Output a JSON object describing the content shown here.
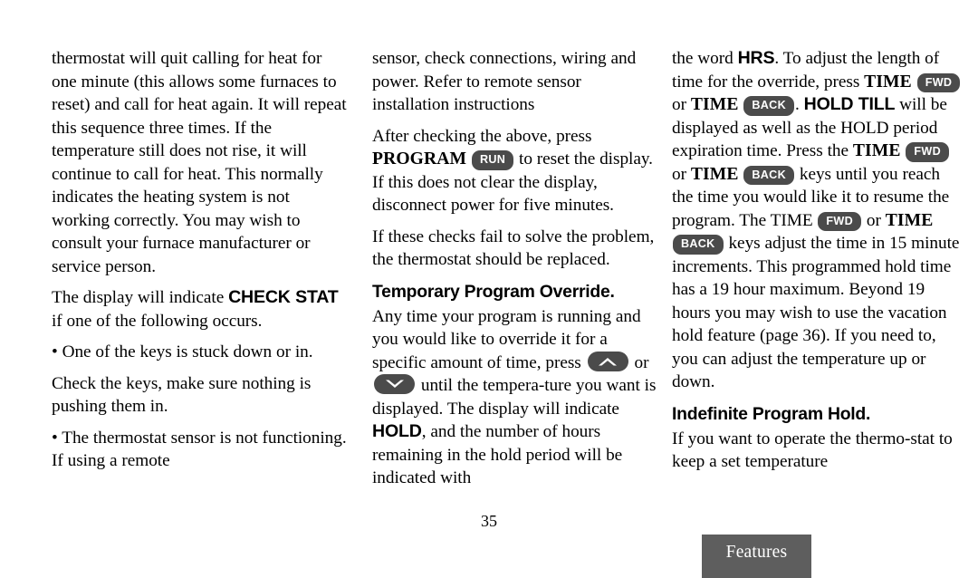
{
  "page": {
    "number": "35",
    "tab_label": "Features",
    "tab_color": "#5e5e5e",
    "key_pill_color": "#4b4b4b",
    "background": "#ffffff"
  },
  "column1": {
    "para1": "thermostat will quit calling for heat for one minute (this allows some furnaces to reset) and call for heat again. It will repeat this sequence three times. If the temperature still does not rise, it will continue to call for heat. This normally indicates the heating system is not working correctly. You may wish to consult your furnace manufacturer or service person.",
    "para2_a": "The display will indicate ",
    "para2_lcd": "CHECK STAT",
    "para2_b": " if one of the following occurs.",
    "bullet1": "• One of the keys is stuck down or in.",
    "para3": "Check the keys, make sure nothing is pushing them in.",
    "bullet2": "• The thermostat sensor is not functioning. If using a remote"
  },
  "column2": {
    "para1": "sensor, check connections, wiring and power. Refer to remote sensor installation instructions",
    "para2_a": "After checking the above, press ",
    "para2_key": "PROGRAM",
    "para2_pill": "RUN",
    "para2_b": " to reset the display. If this does not clear the display, disconnect power for five minutes.",
    "para3": "If these checks fail to solve the problem, the thermostat should be replaced.",
    "heading": "Temporary Program Override.",
    "para4_a": "Any time your program is running and you would like to override it for a specific amount of time, press ",
    "arrow_up": "up-arrow-key",
    "arrow_or": " or ",
    "arrow_down": "down-arrow-key",
    "para4_b": " until the tempera-ture you want is displayed. The display will indicate ",
    "para4_lcd": "HOLD",
    "para4_c": ", and the number of hours remaining in the hold period will be indicated with"
  },
  "column3": {
    "para1_a": "the word ",
    "para1_lcd": "HRS",
    "para1_b": ". To adjust the length of time for the override, press ",
    "time_key": "TIME",
    "pill_fwd": "FWD",
    "pill_back": "BACK",
    "para1_c": " or ",
    "para1_d": ". ",
    "para1_lcd2": "HOLD TILL",
    "para1_e": " will be displayed as well as the HOLD period expiration time. Press the ",
    "para1_f": " or ",
    "para1_g": " keys until you reach the time you would like it to resume the program. The ",
    "para1_h": " or ",
    "para1_i": " keys adjust the time in 15 minute increments. This programmed hold time has a 19 hour maximum. Beyond 19 hours you may wish to use the vacation hold feature (page 36). If you need to, you can adjust the temperature up or down.",
    "heading": "Indefinite Program Hold.",
    "para2": "If you want to operate the thermo-stat to keep a set temperature"
  }
}
